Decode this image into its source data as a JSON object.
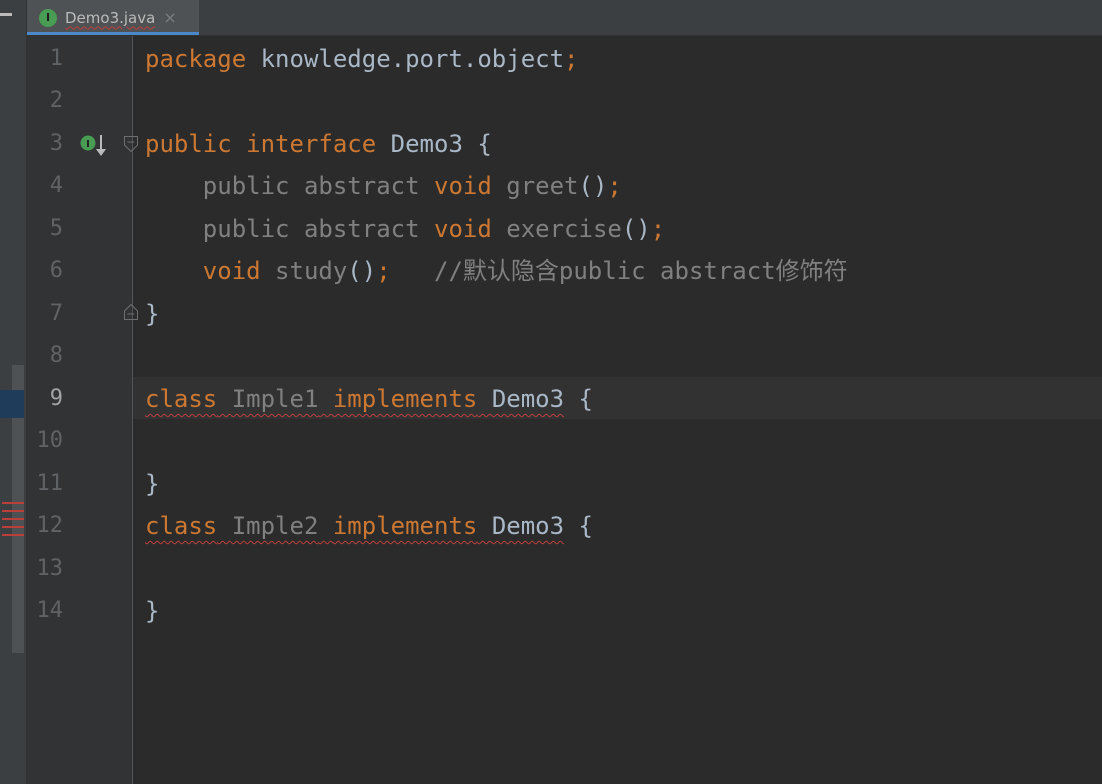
{
  "tab": {
    "icon_letter": "I",
    "title": "Demo3.java",
    "close": "×"
  },
  "lines": [
    {
      "n": "1"
    },
    {
      "n": "2"
    },
    {
      "n": "3"
    },
    {
      "n": "4"
    },
    {
      "n": "5"
    },
    {
      "n": "6"
    },
    {
      "n": "7"
    },
    {
      "n": "8"
    },
    {
      "n": "9"
    },
    {
      "n": "10"
    },
    {
      "n": "11"
    },
    {
      "n": "12"
    },
    {
      "n": "13"
    },
    {
      "n": "14"
    }
  ],
  "code": {
    "l1": {
      "kw": "package",
      "rest": " knowledge.port.object",
      "semi": ";"
    },
    "l3": {
      "kw1": "public",
      "kw2": "interface",
      "name": "Demo3",
      "brace": " {"
    },
    "l4": {
      "mods": "public abstract",
      "kw": "void",
      "name": "greet",
      "parens": "()",
      "semi": ";"
    },
    "l5": {
      "mods": "public abstract",
      "kw": "void",
      "name": "exercise",
      "parens": "()",
      "semi": ";"
    },
    "l6": {
      "kw": "void",
      "name": "study",
      "parens": "()",
      "semi": ";",
      "comment": "//默认隐含public abstract修饰符"
    },
    "l7": {
      "brace": "}"
    },
    "l9": {
      "kw1": "class",
      "name": "Imple1",
      "kw2": "implements",
      "iface": "Demo3",
      "brace": " {"
    },
    "l11": {
      "brace": "}"
    },
    "l12": {
      "kw1": "class",
      "name": "Imple2",
      "kw2": "implements",
      "iface": "Demo3",
      "brace": " {"
    },
    "l14": {
      "brace": "}"
    }
  },
  "current_line": "9",
  "colors": {
    "keyword": "#cc7832",
    "text": "#a9b7c6",
    "comment": "#808080",
    "error": "#bc3f3c",
    "background": "#2b2b2b"
  }
}
